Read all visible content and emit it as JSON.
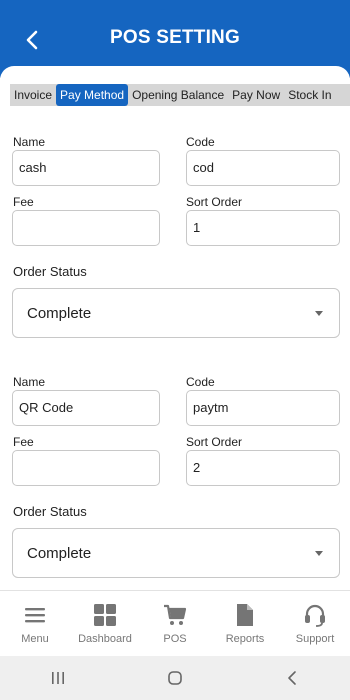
{
  "header": {
    "title": "POS SETTING",
    "back_icon": "chevron-left-icon"
  },
  "tabs": [
    {
      "label": "Invoice",
      "active": false
    },
    {
      "label": "Pay Method",
      "active": true
    },
    {
      "label": "Opening Balance",
      "active": false
    },
    {
      "label": "Pay Now",
      "active": false
    },
    {
      "label": "Stock In",
      "active": false
    }
  ],
  "methods": [
    {
      "name_label": "Name",
      "name_value": "cash",
      "code_label": "Code",
      "code_value": "cod",
      "fee_label": "Fee",
      "fee_value": "",
      "sort_label": "Sort Order",
      "sort_value": "1",
      "status_label": "Order Status",
      "status_value": "Complete"
    },
    {
      "name_label": "Name",
      "name_value": "QR Code",
      "code_label": "Code",
      "code_value": "paytm",
      "fee_label": "Fee",
      "fee_value": "",
      "sort_label": "Sort Order",
      "sort_value": "2",
      "status_label": "Order Status",
      "status_value": "Complete"
    }
  ],
  "bottom_nav": [
    {
      "label": "Menu",
      "icon": "menu-icon"
    },
    {
      "label": "Dashboard",
      "icon": "dashboard-icon"
    },
    {
      "label": "POS",
      "icon": "cart-icon"
    },
    {
      "label": "Reports",
      "icon": "file-icon"
    },
    {
      "label": "Support",
      "icon": "headset-icon"
    }
  ],
  "colors": {
    "primary": "#1565c0",
    "tab_bar": "#d6d6d6",
    "nav_icon": "#757575"
  }
}
